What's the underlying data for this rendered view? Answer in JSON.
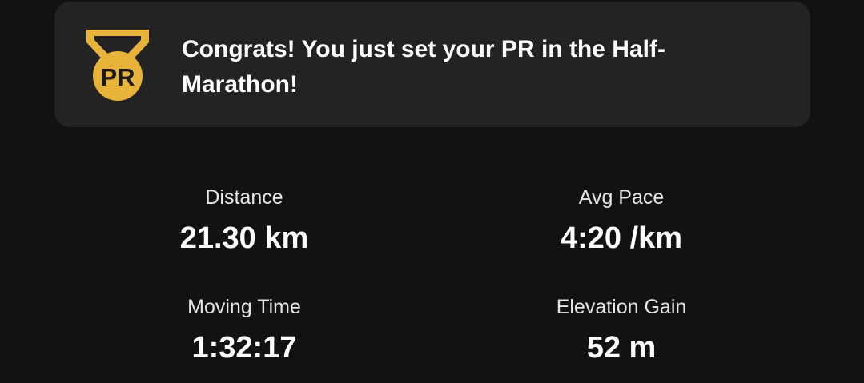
{
  "pr_banner": {
    "message": "Congrats! You just set your PR in the Half-Marathon!",
    "badge_text": "PR",
    "badge_icon": "medal-icon",
    "badge_color": "#E8B33B"
  },
  "stats": {
    "distance": {
      "label": "Distance",
      "value": "21.30 km"
    },
    "avg_pace": {
      "label": "Avg Pace",
      "value": "4:20 /km"
    },
    "moving_time": {
      "label": "Moving Time",
      "value": "1:32:17"
    },
    "elevation_gain": {
      "label": "Elevation Gain",
      "value": "52 m"
    }
  }
}
